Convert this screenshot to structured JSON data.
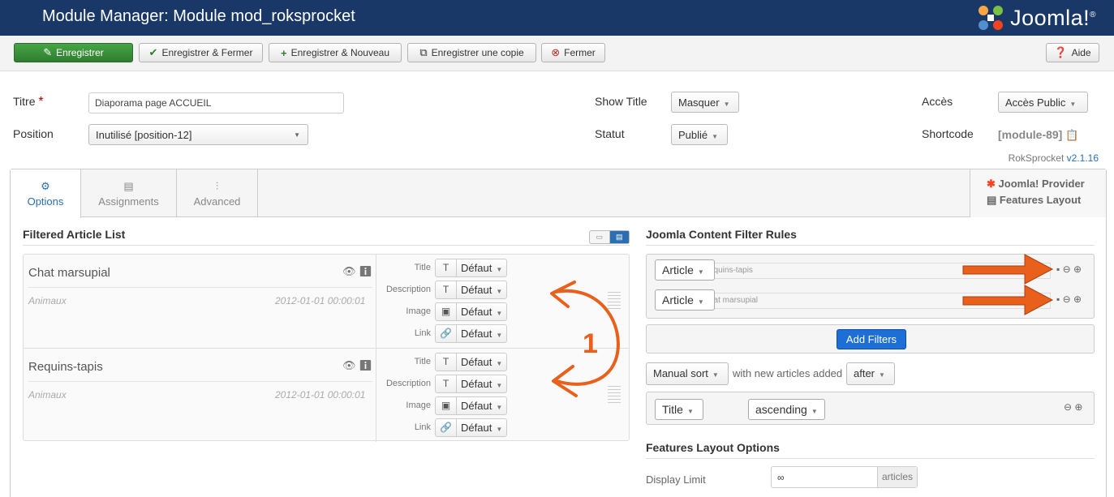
{
  "header": {
    "title": "Module Manager: Module mod_roksprocket",
    "logo_text": "Joomla!",
    "logo_mark": "®"
  },
  "toolbar": {
    "save": "Enregistrer",
    "save_close": "Enregistrer & Fermer",
    "save_new": "Enregistrer & Nouveau",
    "save_copy": "Enregistrer une copie",
    "close": "Fermer",
    "help": "Aide"
  },
  "form": {
    "title_label": "Titre",
    "required_mark": "*",
    "title_value": "Diaporama page ACCUEIL",
    "position_label": "Position",
    "position_value": "Inutilisé [position-12]",
    "show_title_label": "Show Title",
    "show_title_value": "Masquer",
    "status_label": "Statut",
    "status_value": "Publié",
    "access_label": "Accès",
    "access_value": "Accès Public",
    "shortcode_label": "Shortcode",
    "shortcode_value": "[module-89]",
    "version_name": "RokSprocket",
    "version_number": "v2.1.16"
  },
  "tabs": [
    {
      "label": "Options",
      "icon": "gear-icon"
    },
    {
      "label": "Assignments",
      "icon": "list-icon"
    },
    {
      "label": "Advanced",
      "icon": "sliders-icon"
    }
  ],
  "provider": {
    "provider": "Joomla! Provider",
    "layout": "Features Layout"
  },
  "article_list": {
    "heading": "Filtered Article List",
    "prop_labels": [
      "Title",
      "Description",
      "Image",
      "Link"
    ],
    "prop_value": "Défaut",
    "items": [
      {
        "name": "Chat marsupial",
        "category": "Animaux",
        "date": "2012-01-01 00:00:01"
      },
      {
        "name": "Requins-tapis",
        "category": "Animaux",
        "date": "2012-01-01 00:00:01"
      }
    ],
    "annotation_number": "1"
  },
  "filters": {
    "heading": "Joomla Content Filter Rules",
    "rows": [
      {
        "type": "Article",
        "value": "equins-tapis"
      },
      {
        "type": "Article",
        "value": "hat marsupial"
      }
    ],
    "add_label": "Add Filters",
    "sort_value": "Manual sort",
    "sort_text": "with new articles added",
    "sort_position": "after",
    "order_field": "Title",
    "order_dir": "ascending"
  },
  "layout_options": {
    "heading": "Features Layout Options",
    "display_limit_label": "Display Limit",
    "display_limit_value": "∞",
    "display_limit_unit": "articles"
  },
  "colors": {
    "header": "#1a3867",
    "save": "#3a9a3a",
    "accent": "#2a6fb3",
    "add_filters": "#1d6fd6",
    "arrows": "#e8601c"
  }
}
